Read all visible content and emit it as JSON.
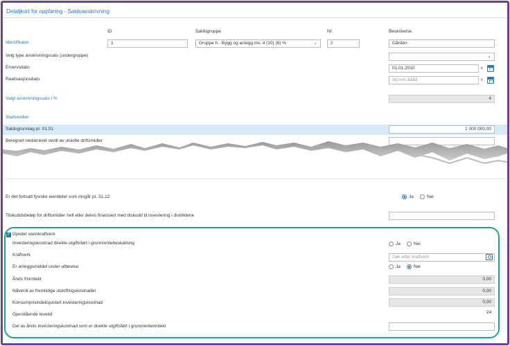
{
  "header": {
    "title": "Detaljkort for oppføring - Saldoavskrivning"
  },
  "columns": {
    "id": "ID",
    "saldogruppe": "Saldogruppe",
    "nr": "Nr.",
    "beskrivelse": "Beskrivelse"
  },
  "identifikator": {
    "label": "Identifikator",
    "id_value": "1",
    "saldogruppe_value": "Gruppe h - Bygg og anlegg mv. 4 (10) (6) %",
    "nr_value": "2",
    "beskrivelse_value": "Gården"
  },
  "velg_type": {
    "label": "Velg type avskrivningssats (undergruppe)",
    "value": ""
  },
  "ervervsdato": {
    "label": "Ervervsdato",
    "value": "01.01.2010"
  },
  "realisasjonsdato": {
    "label": "Realisasjonsdato",
    "placeholder": "dd.mm.åååå"
  },
  "valgt_sats": {
    "label": "Valgt avskrivningssats i %",
    "value": "4"
  },
  "startverdier": {
    "heading": "Startverdier"
  },
  "saldogrunnlag": {
    "label": "Saldogrunnlag pr. 01.01",
    "value": "1 000 000,00"
  },
  "nedskrevet": {
    "label": "Beregnet nedskrevet verdi av utskilte driftsmidler",
    "value": ""
  },
  "fysiske": {
    "label": "Er det fortsatt fysiske eiendeler som inngår pr. 31.12",
    "yes": "Ja",
    "no": "Nei",
    "selected": "Ja"
  },
  "tilskudd": {
    "label": "Tilskuddsbeløp for driftsmidler helt eller delvis finansiert med tilskudd til investering i distriktene",
    "value": ""
  },
  "vannkraft": {
    "checkbox_label": "Gjelder vannkraftverk",
    "checked": true,
    "investering": {
      "label": "Investeringskostnad direkte utgiftsført i grunnrentebeskatning",
      "yes": "Ja",
      "no": "Nei"
    },
    "kraftverk": {
      "label": "Kraftverk",
      "placeholder": "Søk etter kraftverk"
    },
    "under_utforelse": {
      "label": "Er anleggsmiddel under utførelse",
      "yes": "Ja",
      "no": "Nei",
      "selected": "Nei"
    },
    "friinntekt": {
      "label": "Årets friinntekt",
      "value": "0,00"
    },
    "naverdi": {
      "label": "Nåverdi av fremtidige utskiftingskostnader",
      "value": "0,00"
    },
    "konsumpris": {
      "label": "Konsumprisindeksjustert investeringskostnad",
      "value": "0,00"
    },
    "levetid": {
      "label": "Gjenstående levetid",
      "value": "24"
    },
    "del_av_aret": {
      "label": "Del av årets investeringskostnad som er direkte utgiftsført i grunnrenteinntekt",
      "value": ""
    }
  },
  "colors": {
    "accent": "#2a7ab0",
    "frame": "#6b3fa0",
    "highlight": "#1aa58a"
  }
}
